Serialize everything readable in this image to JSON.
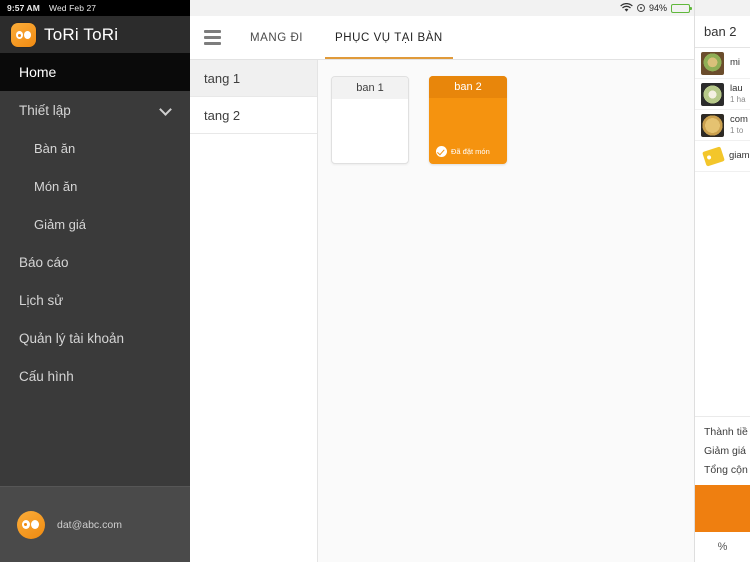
{
  "statusbar": {
    "time": "9:57 AM",
    "date": "Wed Feb 27",
    "battery_pct": "94%",
    "wifi_icon": "wifi-icon",
    "location_icon": "location-icon",
    "battery_icon": "battery-icon"
  },
  "brand": {
    "name": "ToRi ToRi",
    "logo_icon": "tori-logo-icon"
  },
  "sidebar": {
    "items": [
      {
        "label": "Home",
        "active": true,
        "sub": false,
        "chevron": false
      },
      {
        "label": "Thiết lập",
        "active": false,
        "sub": false,
        "chevron": true
      },
      {
        "label": "Bàn ăn",
        "active": false,
        "sub": true,
        "chevron": false
      },
      {
        "label": "Món ăn",
        "active": false,
        "sub": true,
        "chevron": false
      },
      {
        "label": "Giảm giá",
        "active": false,
        "sub": true,
        "chevron": false
      },
      {
        "label": "Báo cáo",
        "active": false,
        "sub": false,
        "chevron": false
      },
      {
        "label": "Lịch sử",
        "active": false,
        "sub": false,
        "chevron": false
      },
      {
        "label": "Quản lý tài khoản",
        "active": false,
        "sub": false,
        "chevron": false
      },
      {
        "label": "Cấu hình",
        "active": false,
        "sub": false,
        "chevron": false
      }
    ],
    "account": {
      "email": "dat@abc.com",
      "avatar_icon": "user-avatar-icon"
    }
  },
  "topbar": {
    "menu_icon": "hamburger-menu-icon",
    "tabs": [
      {
        "label": "MANG ĐI",
        "active": false
      },
      {
        "label": "PHỤC VỤ TẠI BÀN",
        "active": true
      }
    ]
  },
  "floors": [
    {
      "label": "tang 1",
      "selected": true
    },
    {
      "label": "tang 2",
      "selected": false
    }
  ],
  "tables": [
    {
      "name": "ban 1",
      "state": "free",
      "status": ""
    },
    {
      "name": "ban 2",
      "state": "busy",
      "status": "Đã đặt món",
      "status_icon": "check-circle-icon"
    }
  ],
  "order_panel": {
    "title": "ban 2",
    "items": [
      {
        "name": "mi",
        "qty": "",
        "icon": "dish-thumbnail-icon"
      },
      {
        "name": "lau",
        "qty": "1 ha",
        "icon": "dish-thumbnail-icon"
      },
      {
        "name": "com",
        "qty": "1 to",
        "icon": "dish-thumbnail-icon"
      },
      {
        "name": "giam",
        "qty": "",
        "icon": "discount-tag-icon"
      }
    ],
    "summary": [
      {
        "label": "Thành tiề"
      },
      {
        "label": "Giảm giá"
      },
      {
        "label": "Tổng cộn"
      }
    ],
    "pay_button_label": "",
    "percent_label": "%"
  },
  "colors": {
    "accent_orange": "#f5930f",
    "accent_orange_dark": "#e8860b",
    "pay_orange": "#ef7f10",
    "tab_underline": "#e09a3a",
    "sidebar_bg": "#3a3a3a",
    "sidebar_active_bg": "#0a0a0a",
    "battery_green": "#60b83c"
  }
}
